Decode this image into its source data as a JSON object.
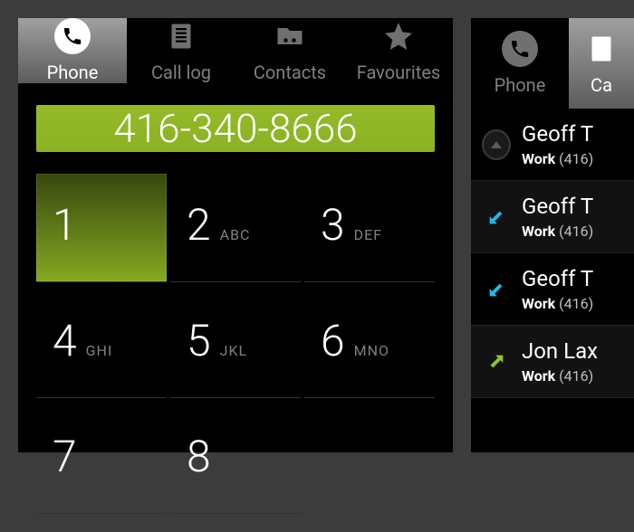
{
  "dialer": {
    "tabs": [
      {
        "label": "Phone",
        "active": true
      },
      {
        "label": "Call log",
        "active": false
      },
      {
        "label": "Contacts",
        "active": false
      },
      {
        "label": "Favourites",
        "active": false
      }
    ],
    "display": "416-340-8666",
    "keys": [
      {
        "digit": "1",
        "sub": ""
      },
      {
        "digit": "2",
        "sub": "ABC"
      },
      {
        "digit": "3",
        "sub": "DEF"
      },
      {
        "digit": "4",
        "sub": "GHI"
      },
      {
        "digit": "5",
        "sub": "JKL"
      },
      {
        "digit": "6",
        "sub": "MNO"
      },
      {
        "digit": "7",
        "sub": ""
      },
      {
        "digit": "8",
        "sub": ""
      }
    ],
    "active_key": "1"
  },
  "calllog": {
    "tabs": [
      {
        "label": "Phone",
        "active": false
      },
      {
        "label": "Ca",
        "active": true
      }
    ],
    "items": [
      {
        "name": "Geoff T",
        "label": "Work",
        "number": "(416)",
        "icon": "scroll-up"
      },
      {
        "name": "Geoff T",
        "label": "Work",
        "number": "(416)",
        "icon": "incoming"
      },
      {
        "name": "Geoff T",
        "label": "Work",
        "number": "(416)",
        "icon": "incoming"
      },
      {
        "name": "Jon Lax",
        "label": "Work",
        "number": "(416)",
        "icon": "outgoing"
      }
    ]
  }
}
